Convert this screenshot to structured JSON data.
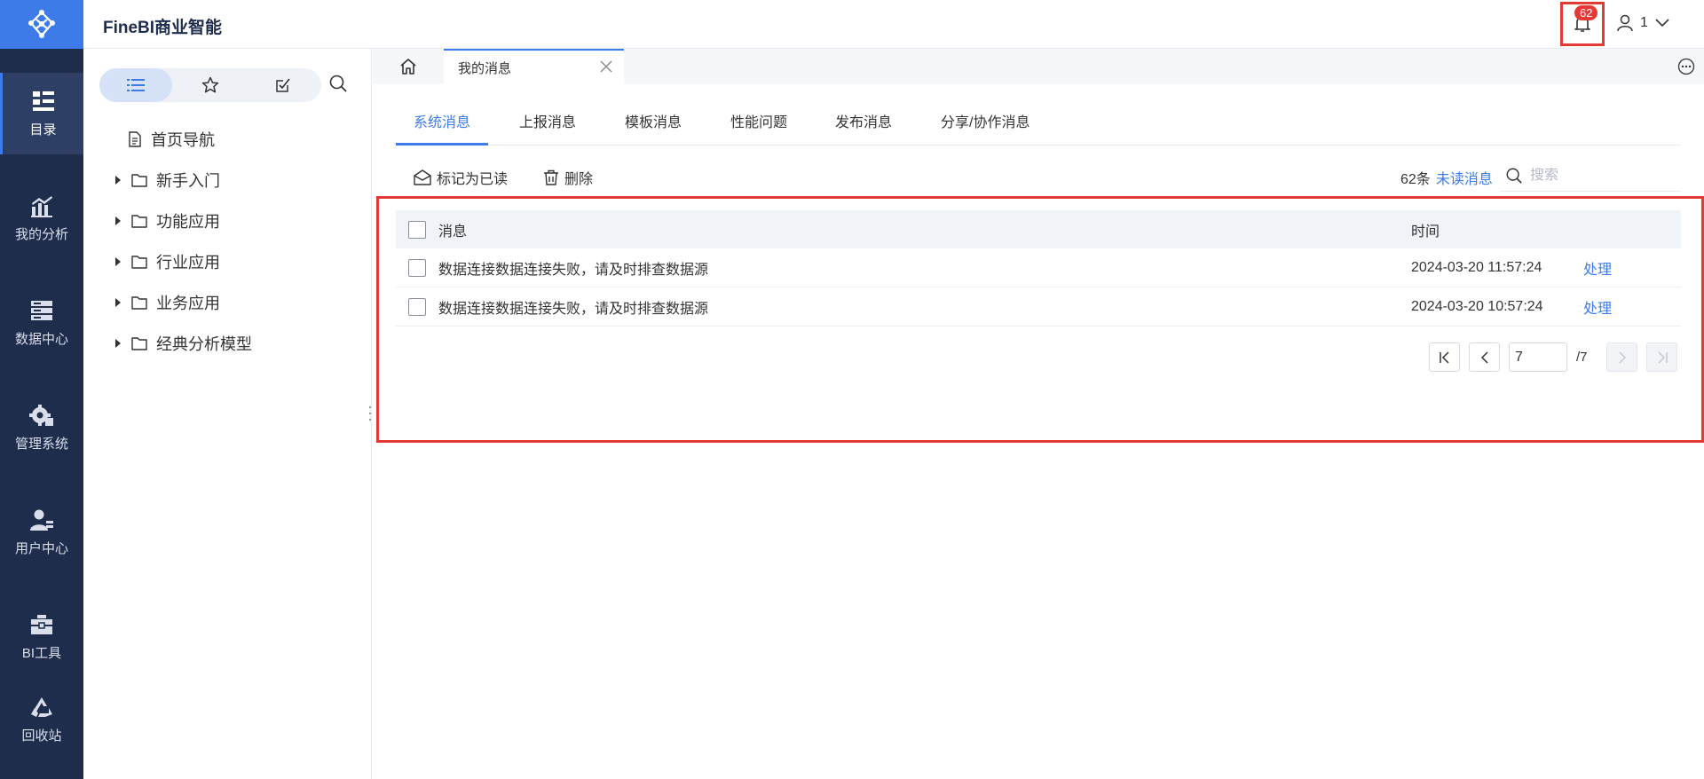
{
  "app": {
    "title": "FineBI商业智能"
  },
  "header": {
    "notification_count": "62",
    "user_name": "1"
  },
  "nav": {
    "items": [
      {
        "label": "目录",
        "icon": "catalog-icon"
      },
      {
        "label": "我的分析",
        "icon": "analysis-icon"
      },
      {
        "label": "数据中心",
        "icon": "data-center-icon"
      },
      {
        "label": "管理系统",
        "icon": "gear-icon"
      },
      {
        "label": "用户中心",
        "icon": "user-center-icon"
      },
      {
        "label": "BI工具",
        "icon": "toolbox-icon"
      },
      {
        "label": "回收站",
        "icon": "recycle-icon"
      }
    ]
  },
  "tree": {
    "items": [
      {
        "label": "首页导航",
        "icon": "document-icon"
      },
      {
        "label": "新手入门",
        "icon": "folder-icon"
      },
      {
        "label": "功能应用",
        "icon": "folder-icon"
      },
      {
        "label": "行业应用",
        "icon": "folder-icon"
      },
      {
        "label": "业务应用",
        "icon": "folder-icon"
      },
      {
        "label": "经典分析模型",
        "icon": "folder-icon"
      }
    ]
  },
  "tabs": {
    "current": "我的消息"
  },
  "messages": {
    "tabs": [
      "系统消息",
      "上报消息",
      "模板消息",
      "性能问题",
      "发布消息",
      "分享/协作消息"
    ],
    "toolbar": {
      "mark_read": "标记为已读",
      "delete": "删除"
    },
    "count": "62条",
    "unread_link": "未读消息",
    "search_placeholder": "搜索",
    "columns": {
      "message": "消息",
      "time": "时间"
    },
    "rows": [
      {
        "message": "数据连接数据连接失败，请及时排查数据源",
        "time": "2024-03-20 11:57:24",
        "action": "处理"
      },
      {
        "message": "数据连接数据连接失败，请及时排查数据源",
        "time": "2024-03-20 10:57:24",
        "action": "处理"
      }
    ],
    "pager": {
      "page": "7",
      "total": "/7"
    }
  },
  "colors": {
    "accent": "#3d7ce8",
    "nav_bg": "#1f2d4d",
    "highlight": "#e53935"
  }
}
